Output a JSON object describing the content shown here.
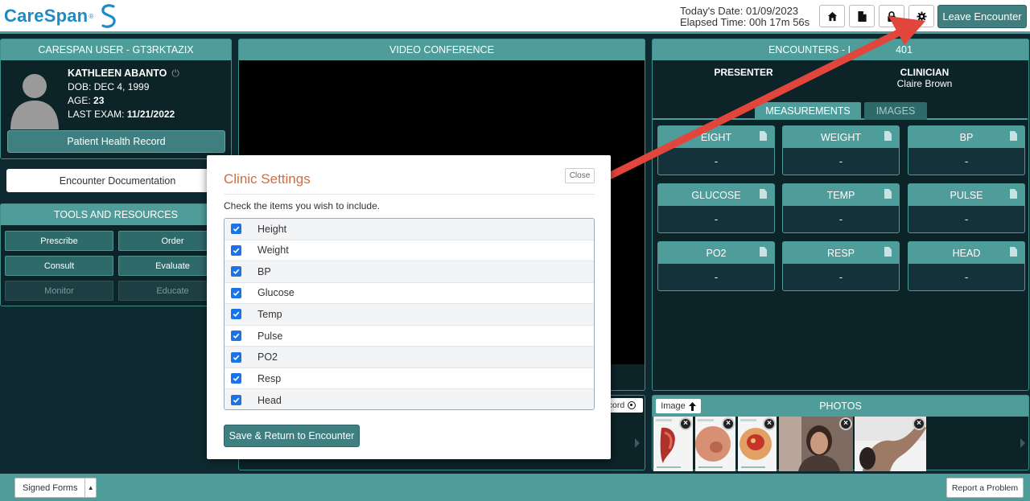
{
  "header": {
    "logo_text": "CareSpan",
    "logo_tm": "®",
    "date_line": "Today's Date: 01/09/2023",
    "elapsed_line": "Elapsed Time: 00h 17m 56s",
    "leave_label": "Leave Encounter"
  },
  "patient": {
    "panel_title": "CARESPAN USER - GT3RKTAZIX",
    "name": "KATHLEEN ABANTO",
    "dob_label": "DOB:",
    "dob": "DEC 4, 1999",
    "age_label": "AGE:",
    "age": "23",
    "last_exam_label": "LAST EXAM:",
    "last_exam": "11/21/2022",
    "phr_label": "Patient Health Record"
  },
  "encounter_doc_label": "Encounter Documentation",
  "tools": {
    "title": "TOOLS AND RESOURCES",
    "buttons": [
      "Prescribe",
      "Order",
      "Consult",
      "Evaluate",
      "Monitor",
      "Educate"
    ]
  },
  "video": {
    "title": "VIDEO CONFERENCE",
    "record_label": "cord"
  },
  "encounters": {
    "title_left": "ENCOUNTERS - I",
    "title_right": "401",
    "presenter_label": "PRESENTER",
    "clinician_label": "CLINICIAN",
    "clinician_name": "Claire Brown",
    "tabs": [
      "MEASUREMENTS",
      "IMAGES"
    ],
    "measurements": [
      {
        "label": "EIGHT",
        "value": "-"
      },
      {
        "label": "WEIGHT",
        "value": "-"
      },
      {
        "label": "BP",
        "value": "-"
      },
      {
        "label": "GLUCOSE",
        "value": "-"
      },
      {
        "label": "TEMP",
        "value": "-"
      },
      {
        "label": "PULSE",
        "value": "-"
      },
      {
        "label": "PO2",
        "value": "-"
      },
      {
        "label": "RESP",
        "value": "-"
      },
      {
        "label": "HEAD",
        "value": "-"
      }
    ]
  },
  "photos": {
    "title": "PHOTOS",
    "image_btn": "Image"
  },
  "footer": {
    "signed_forms": "Signed Forms",
    "report": "Report a Problem"
  },
  "modal": {
    "title": "Clinic Settings",
    "close": "Close",
    "instructions": "Check the items you wish to include.",
    "items": [
      "Height",
      "Weight",
      "BP",
      "Glucose",
      "Temp",
      "Pulse",
      "PO2",
      "Resp",
      "Head"
    ],
    "save_label": "Save & Return to Encounter"
  },
  "colors": {
    "accent": "#4f9d9a",
    "button": "#3f7f80",
    "title_orange": "#d76a3a",
    "arrow_red": "#e2453c",
    "logo_blue": "#1e8bc3"
  }
}
